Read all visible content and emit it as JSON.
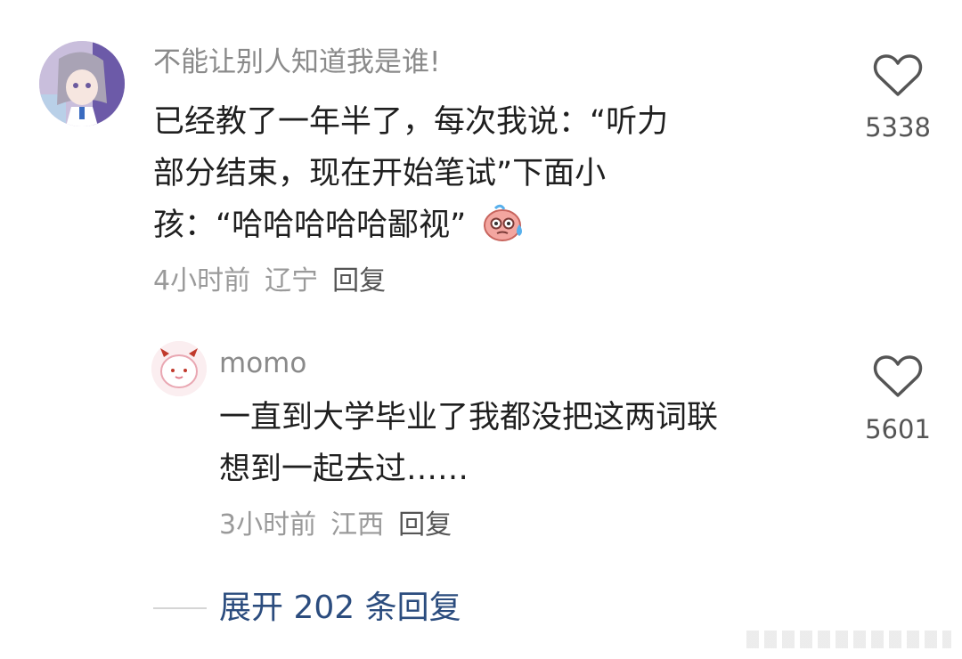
{
  "comment": {
    "username": "不能让别人知道我是谁!",
    "text_lines": [
      "已经教了一年半了，每次我说：“听力",
      "部分结束，现在开始笔试”下面小",
      "孩：“哈哈哈哈哈鄙视”"
    ],
    "time": "4小时前",
    "region": "辽宁",
    "reply_label": "回复",
    "likes": "5338",
    "emoji_icon": "sweating-face-emoji"
  },
  "reply": {
    "username": "momo",
    "text_lines": [
      "一直到大学毕业了我都没把这两词联",
      "想到一起去过……"
    ],
    "time": "3小时前",
    "region": "江西",
    "reply_label": "回复",
    "likes": "5601"
  },
  "expand_replies_label": "展开 202 条回复",
  "colors": {
    "link_blue": "#2b4c7e",
    "muted_gray": "#8a8a8a",
    "text_dark": "#1f1f1f"
  }
}
